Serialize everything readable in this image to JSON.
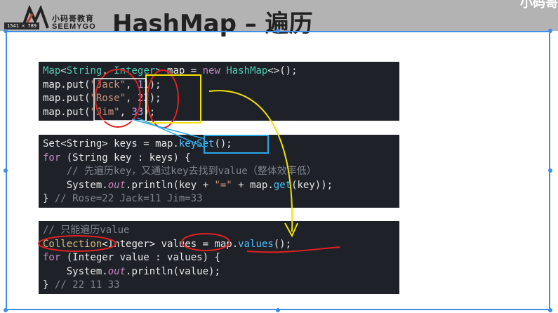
{
  "header": {
    "logo_cn": "小码哥教育",
    "logo_en": "SEEMYGO",
    "title": "HashMap – 遍历",
    "corner": "小码哥",
    "dimension_badge": "1541 × 789"
  },
  "code_block_1": {
    "line1": {
      "type1": "Map",
      "lt": "<",
      "type2": "String",
      "comma": ", ",
      "type3": "Integer",
      "rest": "> map = ",
      "kw": "new",
      "ctor": " HashMap",
      "tail": "<>();"
    },
    "lines": [
      {
        "pre": "map.put(",
        "str": "\"Jack\"",
        "sep": ", ",
        "num": "11",
        "post": ");"
      },
      {
        "pre": "map.put(",
        "str": "\"Rose\"",
        "sep": ", ",
        "num": "22",
        "post": ");"
      },
      {
        "pre": "map.put(",
        "str": "\"Jim\"",
        "sep": ", ",
        "num": "33",
        "post": ");"
      }
    ]
  },
  "code_block_2": {
    "l1_a": "Set<String> keys = map.",
    "l1_b": "keySet",
    "l1_c": "();",
    "l2_kw": "for",
    "l2_rest": " (String key : keys) {",
    "l3_comment": "    // 先遍历key，又通过key去找到value（整体效率低）",
    "l4_a": "    System.",
    "l4_out": "out",
    "l4_b": ".println(key + ",
    "l4_str": "\"=\"",
    "l4_c": " + map.",
    "l4_get": "get",
    "l4_d": "(key));",
    "l5_a": "} ",
    "l5_comment": "// Rose=22 Jack=11 Jim=33"
  },
  "code_block_3": {
    "l1_comment": "// 只能遍历value",
    "l2_type": "Collection",
    "l2_mid": "<Integer> values = map.",
    "l2_method": "values",
    "l2_end": "();",
    "l3_kw": "for",
    "l3_rest": " (Integer value : values) {",
    "l4_a": "    System.",
    "l4_out": "out",
    "l4_b": ".println(value);",
    "l5_a": "} ",
    "l5_comment": "// 22 11 33"
  },
  "colors": {
    "selection": "#3f8ee8",
    "annotation_red": "#e02020",
    "annotation_yellow": "#f2e200",
    "code_bg": "#1e2228"
  }
}
